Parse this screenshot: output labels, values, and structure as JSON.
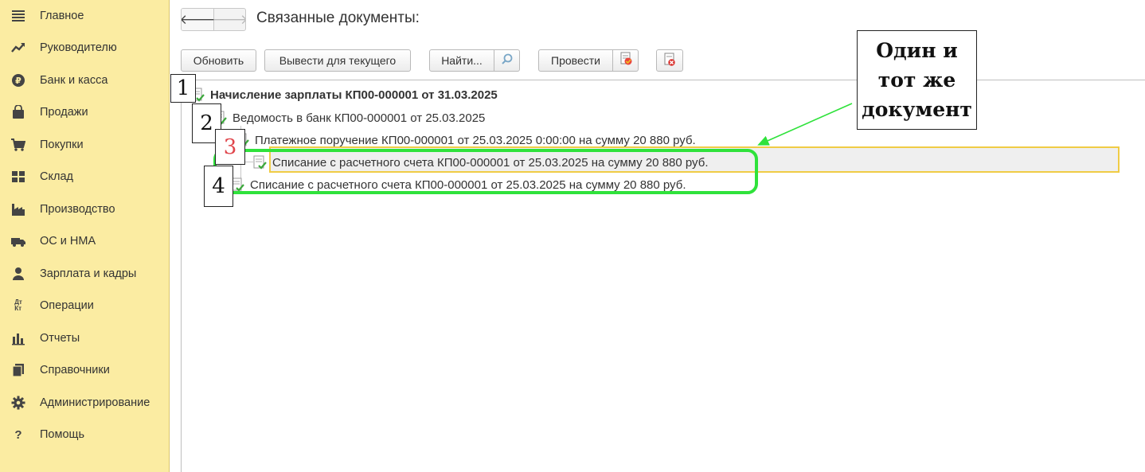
{
  "sidebar": {
    "items": [
      {
        "label": "Главное",
        "icon": "menu-lines-icon"
      },
      {
        "label": "Руководителю",
        "icon": "trend-chart-icon"
      },
      {
        "label": "Банк и касса",
        "icon": "coin-icon"
      },
      {
        "label": "Продажи",
        "icon": "shopping-bag-icon"
      },
      {
        "label": "Покупки",
        "icon": "cart-icon"
      },
      {
        "label": "Склад",
        "icon": "warehouse-grid-icon"
      },
      {
        "label": "Производство",
        "icon": "factory-icon"
      },
      {
        "label": "ОС и НМА",
        "icon": "truck-icon"
      },
      {
        "label": "Зарплата и кадры",
        "icon": "person-icon"
      },
      {
        "label": "Операции",
        "icon": "dt-kt-icon",
        "icon_text": "Дт\nКт"
      },
      {
        "label": "Отчеты",
        "icon": "bar-chart-icon"
      },
      {
        "label": "Справочники",
        "icon": "books-icon"
      },
      {
        "label": "Администрирование",
        "icon": "gear-icon"
      },
      {
        "label": "Помощь",
        "icon": "question-icon",
        "icon_text": "?"
      }
    ]
  },
  "header": {
    "title": "Связанные документы:",
    "back_icon": "arrow-left-icon",
    "forward_icon": "arrow-right-icon",
    "back_glyph": "🡐",
    "forward_glyph": "🡒"
  },
  "toolbar": {
    "refresh_label": "Обновить",
    "output_current_label": "Вывести для текущего",
    "find_label": "Найти...",
    "find_icon": "search-cancel-icon",
    "post_label": "Провести",
    "post_icon": "post-document-icon",
    "delete_icon": "delete-document-icon"
  },
  "tree": {
    "rows": [
      {
        "text": "Начисление зарплаты КП00-000001 от 31.03.2025",
        "bold": true,
        "icon": "document-posted-icon"
      },
      {
        "text": "Ведомость в банк КП00-000001 от 25.03.2025",
        "bold": false,
        "icon": "document-posted-icon"
      },
      {
        "text": "Платежное поручение КП00-000001 от 25.03.2025 0:00:00 на сумму 20 880 руб.",
        "bold": false,
        "icon": "document-posted-icon"
      },
      {
        "text": "Списание с расчетного счета КП00-000001 от 25.03.2025 на сумму 20 880 руб.",
        "bold": false,
        "icon": "document-posted-icon",
        "selected": true
      },
      {
        "text": "Списание с расчетного счета КП00-000001 от 25.03.2025 на сумму 20 880 руб.",
        "bold": false,
        "icon": "document-posted-icon"
      }
    ]
  },
  "annotations": {
    "numbers": [
      "1",
      "2",
      "3",
      "4"
    ],
    "callout_text": "Один и\nтот же\nдокумент",
    "frame_color": "#2fe23b",
    "selection_color": "#f0cc45",
    "number3_color": "#e0454b"
  },
  "colors": {
    "sidebar_bg": "#fbeca2",
    "check_green": "#3aa83a"
  }
}
